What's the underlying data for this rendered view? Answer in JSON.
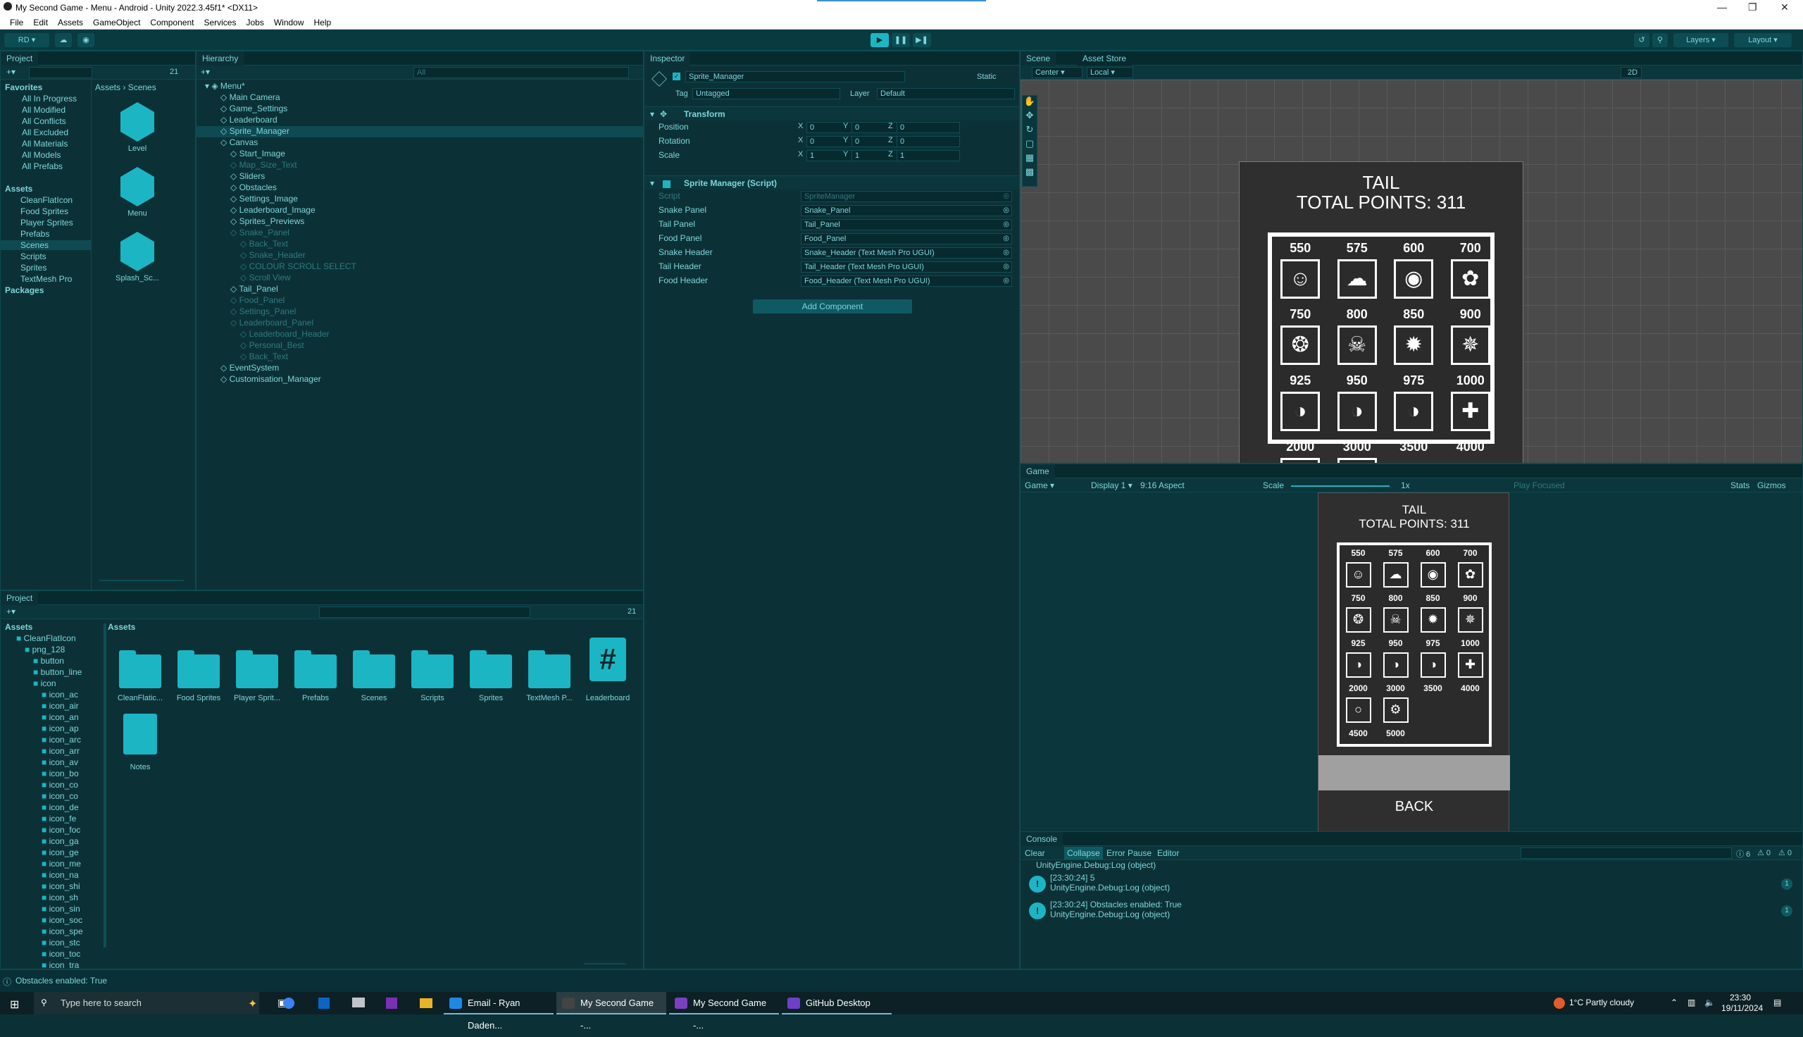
{
  "window": {
    "title": "My Second Game - Menu - Android - Unity 2022.3.45f1* <DX11>"
  },
  "menu": [
    "File",
    "Edit",
    "Assets",
    "GameObject",
    "Component",
    "Services",
    "Jobs",
    "Window",
    "Help"
  ],
  "toolbar": {
    "account": "RD",
    "layers": "Layers",
    "layout": "Layout"
  },
  "project_top": {
    "tab": "Project",
    "count": "21",
    "breadcrumb": [
      "Assets",
      "Scenes"
    ],
    "favorites_label": "Favorites",
    "favorites": [
      "All In Progress",
      "All Modified",
      "All Conflicts",
      "All Excluded",
      "All Materials",
      "All Models",
      "All Prefabs"
    ],
    "assets_label": "Assets",
    "assets": [
      "CleanFlatIcon",
      "Food Sprites",
      "Player Sprites",
      "Prefabs",
      "Scenes",
      "Scripts",
      "Sprites",
      "TextMesh Pro"
    ],
    "packages_label": "Packages",
    "scenes": [
      "Level",
      "Menu",
      "Splash_Sc..."
    ]
  },
  "hierarchy": {
    "tab": "Hierarchy",
    "search_placeholder": "All",
    "root": "Menu*",
    "items": [
      {
        "label": "Main Camera",
        "depth": 1,
        "dim": false
      },
      {
        "label": "Game_Settings",
        "depth": 1,
        "dim": false
      },
      {
        "label": "Leaderboard",
        "depth": 1,
        "dim": false
      },
      {
        "label": "Sprite_Manager",
        "depth": 1,
        "dim": false,
        "selected": true
      },
      {
        "label": "Canvas",
        "depth": 1,
        "dim": false
      },
      {
        "label": "Start_Image",
        "depth": 2,
        "dim": false
      },
      {
        "label": "Map_Size_Text",
        "depth": 2,
        "dim": true
      },
      {
        "label": "Sliders",
        "depth": 2,
        "dim": false
      },
      {
        "label": "Obstacles",
        "depth": 2,
        "dim": false
      },
      {
        "label": "Settings_Image",
        "depth": 2,
        "dim": false
      },
      {
        "label": "Leaderboard_Image",
        "depth": 2,
        "dim": false
      },
      {
        "label": "Sprites_Previews",
        "depth": 2,
        "dim": false
      },
      {
        "label": "Snake_Panel",
        "depth": 2,
        "dim": true
      },
      {
        "label": "Back_Text",
        "depth": 3,
        "dim": true
      },
      {
        "label": "Snake_Header",
        "depth": 3,
        "dim": true
      },
      {
        "label": "COLOUR SCROLL SELECT",
        "depth": 3,
        "dim": true
      },
      {
        "label": "Scroll View",
        "depth": 3,
        "dim": true
      },
      {
        "label": "Tail_Panel",
        "depth": 2,
        "dim": false
      },
      {
        "label": "Food_Panel",
        "depth": 2,
        "dim": true
      },
      {
        "label": "Settings_Panel",
        "depth": 2,
        "dim": true
      },
      {
        "label": "Leaderboard_Panel",
        "depth": 2,
        "dim": true
      },
      {
        "label": "Leaderboard_Header",
        "depth": 3,
        "dim": true
      },
      {
        "label": "Personal_Best",
        "depth": 3,
        "dim": true
      },
      {
        "label": "Back_Text",
        "depth": 3,
        "dim": true
      },
      {
        "label": "EventSystem",
        "depth": 1,
        "dim": false
      },
      {
        "label": "Customisation_Manager",
        "depth": 1,
        "dim": false
      }
    ]
  },
  "inspector": {
    "tab": "Inspector",
    "object_name": "Sprite_Manager",
    "static_label": "Static",
    "tag_label": "Tag",
    "tag_value": "Untagged",
    "layer_label": "Layer",
    "layer_value": "Default",
    "transform_title": "Transform",
    "transform": [
      {
        "label": "Position",
        "x": "0",
        "y": "0",
        "z": "0"
      },
      {
        "label": "Rotation",
        "x": "0",
        "y": "0",
        "z": "0"
      },
      {
        "label": "Scale",
        "x": "1",
        "y": "1",
        "z": "1"
      }
    ],
    "script_title": "Sprite Manager (Script)",
    "fields": [
      {
        "label": "Script",
        "value": "SpriteManager",
        "dim": true
      },
      {
        "label": "Snake Panel",
        "value": "Snake_Panel"
      },
      {
        "label": "Tail Panel",
        "value": "Tail_Panel"
      },
      {
        "label": "Food Panel",
        "value": "Food_Panel"
      },
      {
        "label": "Snake Header",
        "value": "Snake_Header (Text Mesh Pro UGUI)"
      },
      {
        "label": "Tail Header",
        "value": "Tail_Header (Text Mesh Pro UGUI)"
      },
      {
        "label": "Food Header",
        "value": "Food_Header (Text Mesh Pro UGUI)"
      }
    ],
    "add_component": "Add Component"
  },
  "scene": {
    "tabs": [
      "Scene",
      "Asset Store"
    ],
    "pivot": "Center",
    "space": "Local",
    "mode2d": "2D"
  },
  "game_ui": {
    "title": "TAIL",
    "points": "TOTAL POINTS: 311",
    "back": "BACK",
    "costs": [
      "550",
      "575",
      "600",
      "700",
      "750",
      "800",
      "850",
      "900",
      "925",
      "950",
      "975",
      "1000",
      "2000",
      "3000",
      "3500",
      "4000",
      "4500",
      "5000"
    ]
  },
  "game": {
    "tab": "Game",
    "mode": "Game",
    "display": "Display 1",
    "aspect": "9:16 Aspect",
    "scale_label": "Scale",
    "scale_value": "1x",
    "play_focused": "Play Focused",
    "stats": "Stats",
    "gizmos": "Gizmos"
  },
  "project_bottom": {
    "tab": "Project",
    "count": "21",
    "tree_root": "Assets",
    "tree": [
      {
        "label": "CleanFlatIcon",
        "depth": 1
      },
      {
        "label": "png_128",
        "depth": 2
      },
      {
        "label": "button",
        "depth": 3
      },
      {
        "label": "button_line",
        "depth": 3
      },
      {
        "label": "icon",
        "depth": 3
      },
      {
        "label": "icon_ac",
        "depth": 4
      },
      {
        "label": "icon_air",
        "depth": 4
      },
      {
        "label": "icon_an",
        "depth": 4
      },
      {
        "label": "icon_ap",
        "depth": 4
      },
      {
        "label": "icon_arc",
        "depth": 4
      },
      {
        "label": "icon_arr",
        "depth": 4
      },
      {
        "label": "icon_av",
        "depth": 4
      },
      {
        "label": "icon_bo",
        "depth": 4
      },
      {
        "label": "icon_co",
        "depth": 4
      },
      {
        "label": "icon_co",
        "depth": 4
      },
      {
        "label": "icon_de",
        "depth": 4
      },
      {
        "label": "icon_fe",
        "depth": 4
      },
      {
        "label": "icon_foc",
        "depth": 4
      },
      {
        "label": "icon_ga",
        "depth": 4
      },
      {
        "label": "icon_ge",
        "depth": 4
      },
      {
        "label": "icon_me",
        "depth": 4
      },
      {
        "label": "icon_na",
        "depth": 4
      },
      {
        "label": "icon_shi",
        "depth": 4
      },
      {
        "label": "icon_sh",
        "depth": 4
      },
      {
        "label": "icon_sin",
        "depth": 4
      },
      {
        "label": "icon_soc",
        "depth": 4
      },
      {
        "label": "icon_spe",
        "depth": 4
      },
      {
        "label": "icon_stc",
        "depth": 4
      },
      {
        "label": "icon_toc",
        "depth": 4
      },
      {
        "label": "icon_tra",
        "depth": 4
      }
    ],
    "breadcrumb": "Assets",
    "folders": [
      "CleanFlatic...",
      "Food Sprites",
      "Player Sprit...",
      "Prefabs",
      "Scenes",
      "Scripts",
      "Sprites",
      "TextMesh P..."
    ],
    "leaderboard_label": "Leaderboard",
    "notes_label": "Notes"
  },
  "console": {
    "tab": "Console",
    "buttons": [
      "Clear",
      "Collapse",
      "Error Pause",
      "Editor"
    ],
    "counts": [
      "6",
      "0",
      "0"
    ],
    "truncated_line": "UnityEngine.Debug:Log (object)",
    "logs": [
      {
        "line1": "[23:30:24] 5",
        "line2": "UnityEngine.Debug:Log (object)",
        "count": "1"
      },
      {
        "line1": "[23:30:24] Obstacles enabled: True",
        "line2": "UnityEngine.Debug:Log (object)",
        "count": "1"
      }
    ]
  },
  "status": {
    "message": "Obstacles enabled: True"
  },
  "taskbar": {
    "search_placeholder": "Type here to search",
    "apps": [
      {
        "label": "Email - Ryan Daden...",
        "color": "#1e88e5"
      },
      {
        "label": "My Second Game -...",
        "color": "#444444"
      },
      {
        "label": "My Second Game -...",
        "color": "#7b3fbf"
      },
      {
        "label": "GitHub Desktop",
        "color": "#6e40c9"
      }
    ],
    "weather": "1°C  Partly cloudy",
    "time": "23:30",
    "date": "19/11/2024"
  },
  "colors": {
    "accent": "#1cb5c3",
    "editor_bg": "#0b3136",
    "selection": "#0f4a52"
  }
}
